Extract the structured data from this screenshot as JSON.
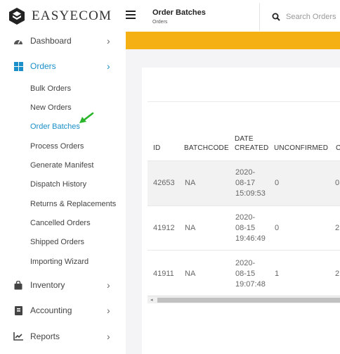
{
  "brand": {
    "name": "EASYECOM"
  },
  "header": {
    "title": "Order Batches",
    "breadcrumb": "Orders",
    "search_placeholder": "Search Orders"
  },
  "sidebar": {
    "items": [
      {
        "label": "Dashboard",
        "icon": "dashboard-gauge-icon"
      },
      {
        "label": "Orders",
        "icon": "orders-grid-icon",
        "active": true
      },
      {
        "label": "Inventory",
        "icon": "inventory-bag-icon"
      },
      {
        "label": "Accounting",
        "icon": "accounting-book-icon"
      },
      {
        "label": "Reports",
        "icon": "reports-chart-icon"
      }
    ],
    "orders_sub": [
      "Bulk Orders",
      "New Orders",
      "Order Batches",
      "Process Orders",
      "Generate Manifest",
      "Dispatch History",
      "Returns & Replacements",
      "Cancelled Orders",
      "Shipped Orders",
      "Importing Wizard"
    ],
    "active_sub": "Order Batches"
  },
  "table": {
    "columns": [
      "ID",
      "BATCHCODE",
      "DATE CREATED",
      "UNCONFIRMED",
      "C"
    ],
    "rows": [
      {
        "id": "42653",
        "batchcode": "NA",
        "date": [
          "2020-",
          "08-17",
          "15:09:53"
        ],
        "unconfirmed": "0",
        "next": "0"
      },
      {
        "id": "41912",
        "batchcode": "NA",
        "date": [
          "2020-",
          "08-15",
          "19:46:49"
        ],
        "unconfirmed": "0",
        "next": "2"
      },
      {
        "id": "41911",
        "batchcode": "NA",
        "date": [
          "2020-",
          "08-15",
          "19:07:48"
        ],
        "unconfirmed": "1",
        "next": "2"
      }
    ]
  },
  "colors": {
    "accent": "#1a8fc9",
    "banner": "#f5b014",
    "annotation_arrow": "#2bb52b"
  }
}
